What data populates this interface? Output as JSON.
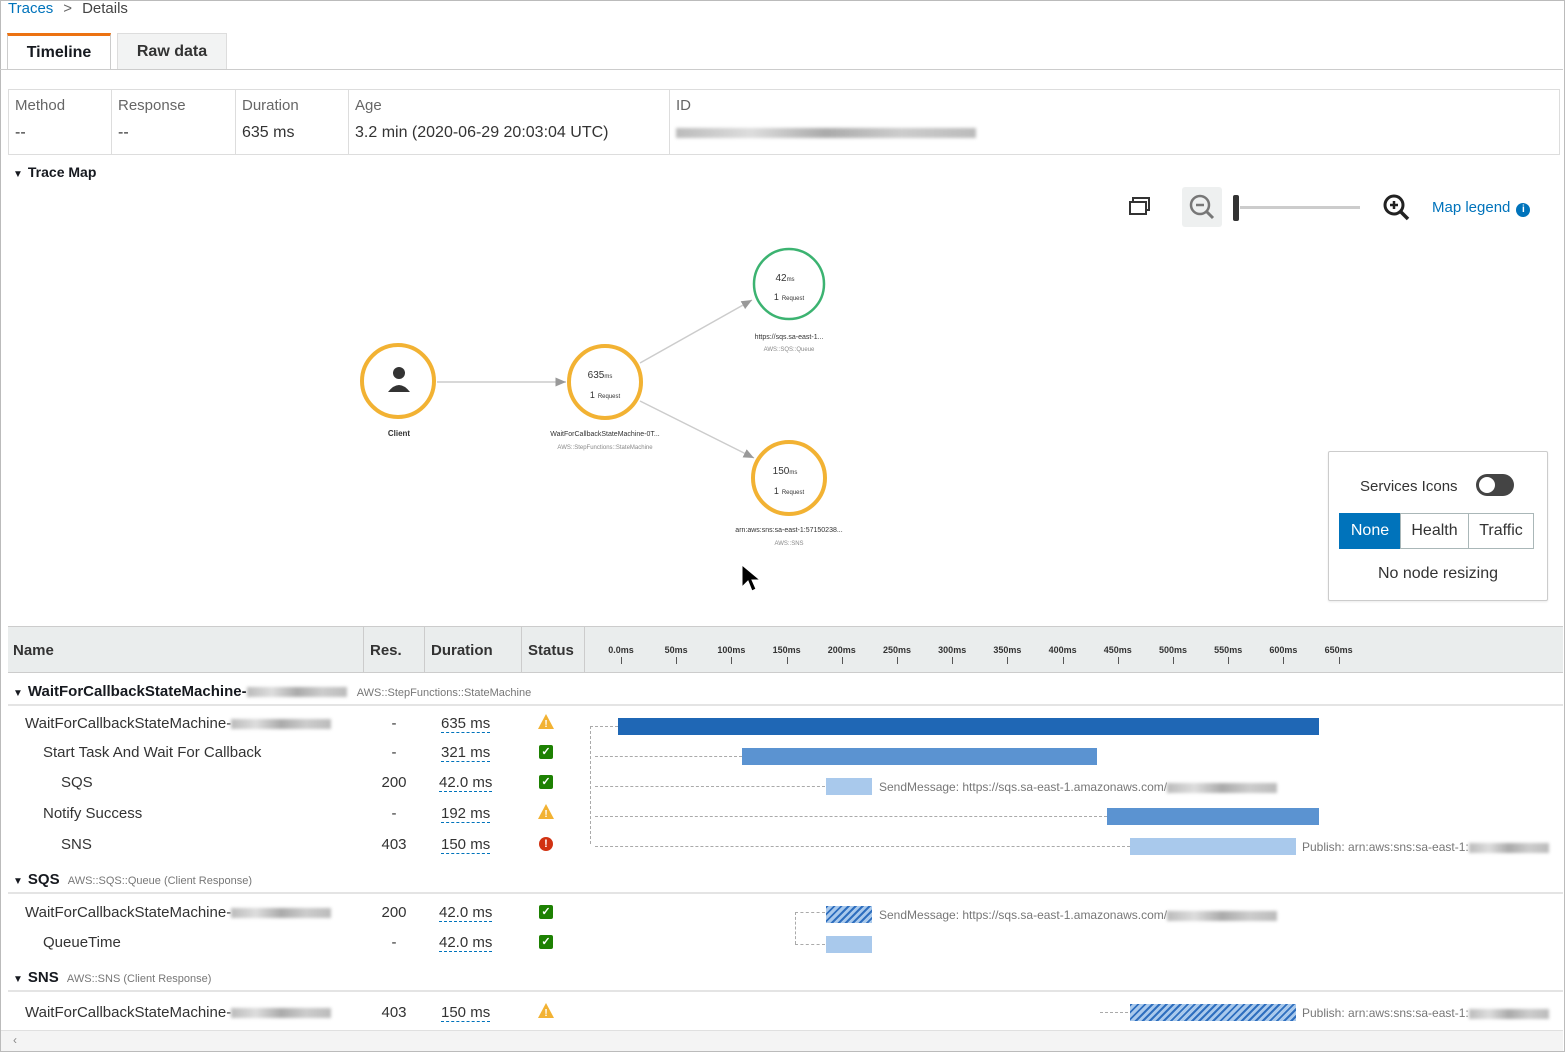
{
  "breadcrumb": {
    "link": "Traces",
    "separator": ">",
    "current": "Details"
  },
  "tabs": {
    "timeline": "Timeline",
    "raw": "Raw data"
  },
  "summary": {
    "method_label": "Method",
    "method_value": "--",
    "response_label": "Response",
    "response_value": "--",
    "duration_label": "Duration",
    "duration_value": "635 ms",
    "age_label": "Age",
    "age_value": "3.2 min (2020-06-29 20:03:04 UTC)",
    "id_label": "ID"
  },
  "trace_map": {
    "title": "Trace Map",
    "map_legend": "Map legend",
    "nodes": {
      "client": {
        "name": "Client"
      },
      "state": {
        "ms": "635",
        "unit": "ms",
        "req": "1",
        "req_label": "Request",
        "name": "WaitForCallbackStateMachine-0T...",
        "type": "AWS::StepFunctions::StateMachine"
      },
      "sqs": {
        "ms": "42",
        "unit": "ms",
        "req": "1",
        "req_label": "Request",
        "name": "https://sqs.sa-east-1...",
        "type": "AWS::SQS::Queue"
      },
      "sns": {
        "ms": "150",
        "unit": "ms",
        "req": "1",
        "req_label": "Request",
        "name": "arn:aws:sns:sa-east-1:57150238...",
        "type": "AWS::SNS"
      }
    },
    "panel": {
      "services_icons": "Services Icons",
      "seg_none": "None",
      "seg_health": "Health",
      "seg_traffic": "Traffic",
      "no_resize": "No node resizing"
    }
  },
  "table": {
    "headers": {
      "name": "Name",
      "res": "Res.",
      "duration": "Duration",
      "status": "Status"
    },
    "ticks": [
      "0.0ms",
      "50ms",
      "100ms",
      "150ms",
      "200ms",
      "250ms",
      "300ms",
      "350ms",
      "400ms",
      "450ms",
      "500ms",
      "550ms",
      "600ms",
      "650ms"
    ],
    "groups": {
      "g1": {
        "name": "WaitForCallbackStateMachine-",
        "sub": "AWS::StepFunctions::StateMachine"
      },
      "g2": {
        "name": "SQS",
        "sub": "AWS::SQS::Queue (Client Response)"
      },
      "g3": {
        "name": "SNS",
        "sub": "AWS::SNS (Client Response)"
      }
    },
    "rows": [
      {
        "name": "WaitForCallbackStateMachine-",
        "res": "-",
        "dur": "635 ms"
      },
      {
        "name": "Start Task And Wait For Callback",
        "res": "-",
        "dur": "321 ms"
      },
      {
        "name": "SQS",
        "res": "200",
        "dur": "42.0 ms",
        "label": "SendMessage: https://sqs.sa-east-1.amazonaws.com/"
      },
      {
        "name": "Notify Success",
        "res": "-",
        "dur": "192 ms"
      },
      {
        "name": "SNS",
        "res": "403",
        "dur": "150 ms",
        "label": "Publish: arn:aws:sns:sa-east-1:"
      },
      {
        "name": "WaitForCallbackStateMachine-",
        "res": "200",
        "dur": "42.0 ms",
        "label": "SendMessage: https://sqs.sa-east-1.amazonaws.com/"
      },
      {
        "name": "QueueTime",
        "res": "-",
        "dur": "42.0 ms"
      },
      {
        "name": "WaitForCallbackStateMachine-",
        "res": "403",
        "dur": "150 ms",
        "label": "Publish: arn:aws:sns:sa-east-1:"
      }
    ]
  },
  "colors": {
    "accent": "#0073bb",
    "tab_accent": "#ec7211",
    "node_orange": "#f2b233",
    "node_green": "#3cb371",
    "ok": "#1d8102",
    "error": "#d13212",
    "warning": "#f2b233"
  },
  "icons": [
    "chevron-right-icon",
    "caret-down-icon",
    "fit-view-icon",
    "zoom-out-icon",
    "zoom-in-icon",
    "info-icon",
    "user-icon",
    "check-icon",
    "warning-icon",
    "error-icon",
    "cursor-icon"
  ]
}
